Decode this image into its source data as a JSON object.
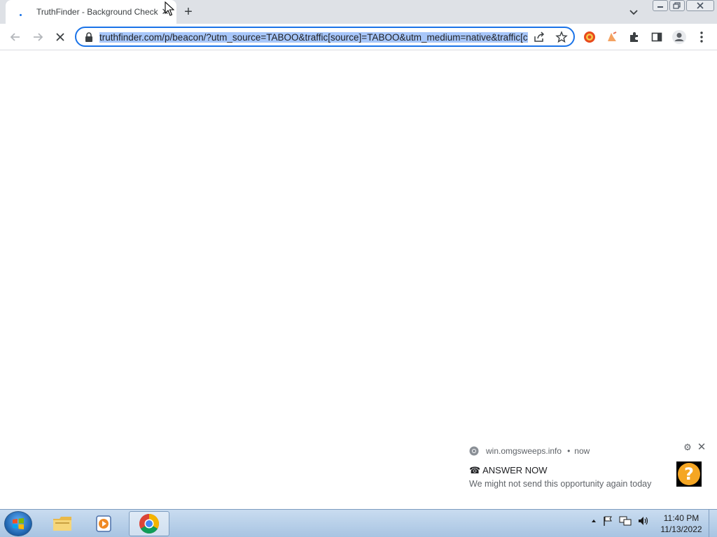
{
  "tab": {
    "title": "TruthFinder - Background Check",
    "close_glyph": "✕"
  },
  "new_tab_glyph": "+",
  "address_bar": {
    "url": "truthfinder.com/p/beacon/?utm_source=TABOO&traffic[source]=TABOO&utm_medium=native&traffic[campaign]"
  },
  "notification": {
    "source": "win.omgsweeps.info",
    "separator": "•",
    "time": "now",
    "title": "☎ ANSWER NOW",
    "body": "We might not send this opportunity again today",
    "image_glyph": "?",
    "settings_glyph": "⚙",
    "close_glyph": "✕"
  },
  "taskbar": {
    "time": "11:40 PM",
    "date": "11/13/2022"
  },
  "colors": {
    "accent": "#1a73e8",
    "url_highlight": "#a8c7fa",
    "tabstrip": "#dee1e6",
    "notif_image": "#f5a623"
  }
}
